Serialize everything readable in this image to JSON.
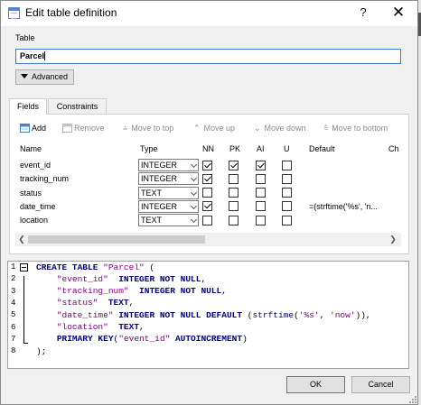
{
  "window": {
    "title": "Edit table definition",
    "help_label": "?",
    "close_label": "✕"
  },
  "table_group": {
    "label": "Table",
    "name_value": "Parcel",
    "advanced_label": "Advanced"
  },
  "tabs": [
    {
      "label": "Fields"
    },
    {
      "label": "Constraints"
    }
  ],
  "toolbar": {
    "add": "Add",
    "remove": "Remove",
    "move_top": "Move to top",
    "move_up": "Move up",
    "move_down": "Move down",
    "move_bottom": "Move to bottom"
  },
  "columns": [
    "Name",
    "Type",
    "NN",
    "PK",
    "AI",
    "U",
    "Default",
    "Ch"
  ],
  "fields": [
    {
      "name": "event_id",
      "type": "INTEGER",
      "nn": true,
      "pk": true,
      "ai": true,
      "u": false,
      "default": ""
    },
    {
      "name": "tracking_num",
      "type": "INTEGER",
      "nn": true,
      "pk": false,
      "ai": false,
      "u": false,
      "default": ""
    },
    {
      "name": "status",
      "type": "TEXT",
      "nn": false,
      "pk": false,
      "ai": false,
      "u": false,
      "default": ""
    },
    {
      "name": "date_time",
      "type": "INTEGER",
      "nn": true,
      "pk": false,
      "ai": false,
      "u": false,
      "default": "=(strftime('%s', 'n..."
    },
    {
      "name": "location",
      "type": "TEXT",
      "nn": false,
      "pk": false,
      "ai": false,
      "u": false,
      "default": ""
    }
  ],
  "sql": {
    "line_numbers": [
      "1",
      "2",
      "3",
      "4",
      "5",
      "6",
      "7",
      "8"
    ],
    "lines": [
      [
        {
          "t": "CREATE TABLE ",
          "c": "kw"
        },
        {
          "t": "\"Parcel\"",
          "c": "str"
        },
        {
          "t": " (",
          "c": "punc"
        }
      ],
      [
        {
          "t": "    ",
          "c": "punc"
        },
        {
          "t": "\"event_id\"",
          "c": "str"
        },
        {
          "t": "  ",
          "c": "punc"
        },
        {
          "t": "INTEGER NOT NULL",
          "c": "kw"
        },
        {
          "t": ",",
          "c": "punc"
        }
      ],
      [
        {
          "t": "    ",
          "c": "punc"
        },
        {
          "t": "\"tracking_num\"",
          "c": "str"
        },
        {
          "t": "  ",
          "c": "punc"
        },
        {
          "t": "INTEGER NOT NULL",
          "c": "kw"
        },
        {
          "t": ",",
          "c": "punc"
        }
      ],
      [
        {
          "t": "    ",
          "c": "punc"
        },
        {
          "t": "\"status\"",
          "c": "str"
        },
        {
          "t": "  ",
          "c": "punc"
        },
        {
          "t": "TEXT",
          "c": "kw"
        },
        {
          "t": ",",
          "c": "punc"
        }
      ],
      [
        {
          "t": "    ",
          "c": "punc"
        },
        {
          "t": "\"date_time\"",
          "c": "str"
        },
        {
          "t": " ",
          "c": "punc"
        },
        {
          "t": "INTEGER NOT NULL DEFAULT",
          "c": "kw"
        },
        {
          "t": " (",
          "c": "punc"
        },
        {
          "t": "strftime",
          "c": "fn"
        },
        {
          "t": "(",
          "c": "punc"
        },
        {
          "t": "'%s'",
          "c": "str"
        },
        {
          "t": ", ",
          "c": "punc"
        },
        {
          "t": "'now'",
          "c": "str"
        },
        {
          "t": ")),",
          "c": "punc"
        }
      ],
      [
        {
          "t": "    ",
          "c": "punc"
        },
        {
          "t": "\"location\"",
          "c": "str"
        },
        {
          "t": "  ",
          "c": "punc"
        },
        {
          "t": "TEXT",
          "c": "kw"
        },
        {
          "t": ",",
          "c": "punc"
        }
      ],
      [
        {
          "t": "    ",
          "c": "punc"
        },
        {
          "t": "PRIMARY KEY",
          "c": "kw"
        },
        {
          "t": "(",
          "c": "punc"
        },
        {
          "t": "\"event_id\"",
          "c": "str"
        },
        {
          "t": " ",
          "c": "punc"
        },
        {
          "t": "AUTOINCREMENT",
          "c": "kw"
        },
        {
          "t": ")",
          "c": "punc"
        }
      ],
      [
        {
          "t": ");",
          "c": "punc"
        }
      ]
    ]
  },
  "buttons": {
    "ok": "OK",
    "cancel": "Cancel"
  },
  "colors": {
    "accent": "#3c7bd0",
    "keyword": "#000080",
    "string": "#800080"
  }
}
